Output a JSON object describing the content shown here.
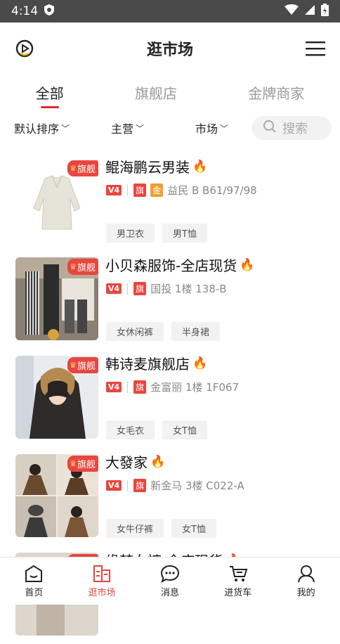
{
  "status": {
    "time": "4:14"
  },
  "header": {
    "title": "逛市场"
  },
  "tabs": [
    {
      "label": "全部"
    },
    {
      "label": "旗舰店"
    },
    {
      "label": "金牌商家"
    }
  ],
  "filters": {
    "sort": "默认排序",
    "main": "主营",
    "market": "市场",
    "search_placeholder": "搜索"
  },
  "shops": [
    {
      "name": "鲲海鹏云男装",
      "badge": "旗舰",
      "v_label": "V4",
      "qi": "旗",
      "jin": "金",
      "location": "益民 B B61/97/98",
      "tags": [
        "男卫衣",
        "男T恤"
      ]
    },
    {
      "name": "小贝森服饰-全店现货",
      "badge": "旗舰",
      "v_label": "V4",
      "qi": "旗",
      "location": "国投 1楼 138-B",
      "tags": [
        "女休闲裤",
        "半身裙"
      ]
    },
    {
      "name": "韩诗麦旗舰店",
      "badge": "旗舰",
      "v_label": "V4",
      "qi": "旗",
      "location": "金富丽 1楼 1F067",
      "tags": [
        "女毛衣",
        "女T恤"
      ]
    },
    {
      "name": "大發家",
      "badge": "旗舰",
      "v_label": "V4",
      "qi": "旗",
      "location": "新金马 3楼 C022-A",
      "tags": [
        "女牛仔裤",
        "女T恤"
      ]
    },
    {
      "name": "缘梦女裤-全店现货",
      "badge": "旗舰"
    }
  ],
  "bottom_nav": [
    {
      "label": "首页",
      "icon": "home-icon"
    },
    {
      "label": "逛市场",
      "icon": "market-icon",
      "active": true
    },
    {
      "label": "消息",
      "icon": "message-icon"
    },
    {
      "label": "进货车",
      "icon": "cart-icon"
    },
    {
      "label": "我的",
      "icon": "profile-icon"
    }
  ],
  "colors": {
    "accent": "#e8463f",
    "gold": "#f0a030"
  }
}
